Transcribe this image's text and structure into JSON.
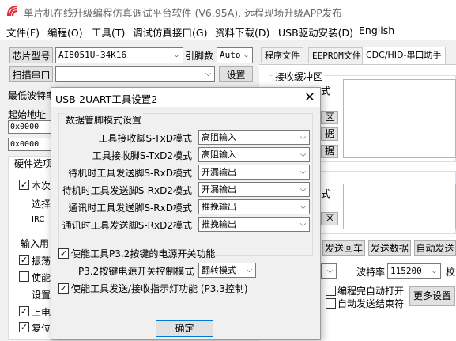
{
  "app": {
    "title": "单片机在线升级编程仿真调试平台软件 (V6.95A), 远程现场升级APP发布"
  },
  "menu": [
    "文件(F)",
    "编程(O)",
    "工具(T)",
    "调试仿真接口(G)",
    "资料下载(D)",
    "USB驱动安装(D)",
    "English"
  ],
  "main": {
    "chip_type_label": "芯片型号",
    "chip_type_value": "AI8051U-34K16",
    "pin_count_label": "引脚数",
    "pin_count_value": "Auto",
    "scan_port_label": "扫描串口",
    "port_value": "",
    "settings_button": "设置",
    "min_baud_label": "最低波特率",
    "start_addr_label": "起始地址",
    "addr1": "0x0000",
    "addr2": "0x0000",
    "hw_options_label": "硬件选项",
    "left_partial": [
      "本次",
      "选择",
      "IRC",
      "输入用",
      "振荡",
      "使能",
      "设置",
      "上电",
      "复位"
    ]
  },
  "tabs": [
    "程序文件",
    "EEPROM文件",
    "CDC/HID-串口助手"
  ],
  "right_panel": {
    "recv_buffer_label": "接收缓冲区",
    "partial_labels": [
      "式",
      "区",
      "据",
      "据",
      "式",
      "区"
    ],
    "send_return_button": "发送回车",
    "send_data_button": "发送数据",
    "auto_send_button": "自动发送",
    "baud_label": "波特率",
    "baud_value": "115200",
    "partial_check": "校",
    "auto_open_label": "编程完自动打开",
    "auto_send_end_label": "自动发送结束符",
    "more_settings_button": "更多设置"
  },
  "dialog": {
    "title": "USB-2UART工具设置2",
    "close_icon": "close-icon",
    "group_title": "数据管脚模式设置",
    "rows": [
      {
        "label": "工具接收脚S-TxD模式",
        "value": "高阻输入"
      },
      {
        "label": "工具接收脚S-TxD2模式",
        "value": "高阻输入"
      },
      {
        "label": "待机时工具发送脚S-RxD模式",
        "value": "开漏输出"
      },
      {
        "label": "待机时工具发送脚S-RxD2模式",
        "value": "开漏输出"
      },
      {
        "label": "通讯时工具发送脚S-RxD模式",
        "value": "推挽输出"
      },
      {
        "label": "通讯时工具发送脚S-RxD2模式",
        "value": "推挽输出"
      }
    ],
    "power_check_label": "使能工具P3.2按键的电源开关功能",
    "power_mode_label": "P3.2按键电源开关控制模式",
    "power_mode_value": "翻转模式",
    "led_check_label": "使能工具发送/接收指示灯功能 (P3.3控制)",
    "ok_button": "确定"
  },
  "colors": {
    "accent": "#0078d7",
    "icon_red": "#e0303a"
  }
}
